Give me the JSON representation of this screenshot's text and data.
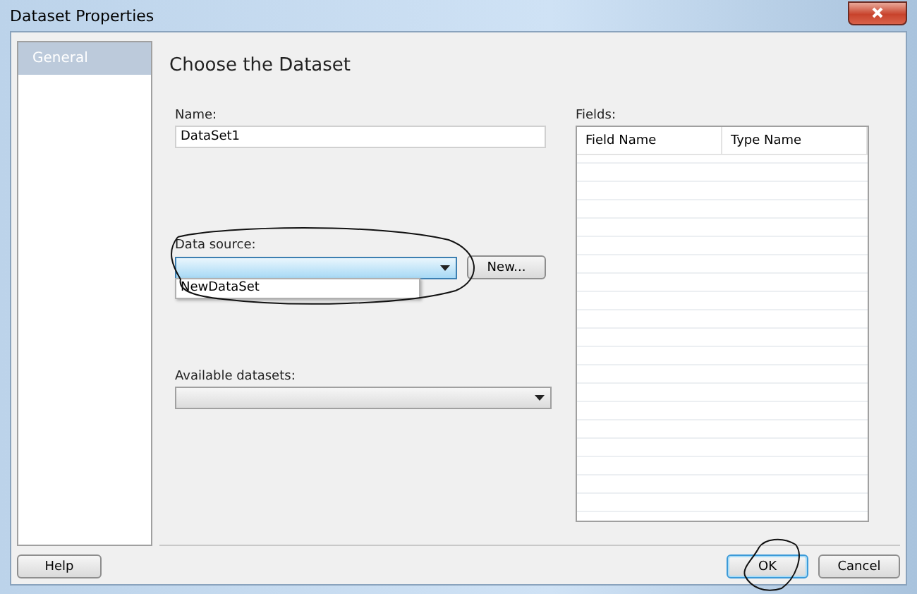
{
  "window": {
    "title": "Dataset Properties"
  },
  "sidebar": {
    "items": [
      {
        "label": "General",
        "selected": true
      }
    ]
  },
  "heading": "Choose the Dataset",
  "name_field": {
    "label": "Name:",
    "value": "DataSet1"
  },
  "data_source": {
    "label": "Data source:",
    "expanded": true,
    "options": [
      "NewDataSet"
    ],
    "new_button": "New..."
  },
  "available_datasets": {
    "label": "Available datasets:"
  },
  "fields": {
    "label": "Fields:",
    "columns": [
      "Field Name",
      "Type Name"
    ]
  },
  "buttons": [
    {
      "label": "Help",
      "focused": false
    },
    {
      "label": "OK",
      "focused": true
    },
    {
      "label": "Cancel",
      "focused": false
    }
  ]
}
